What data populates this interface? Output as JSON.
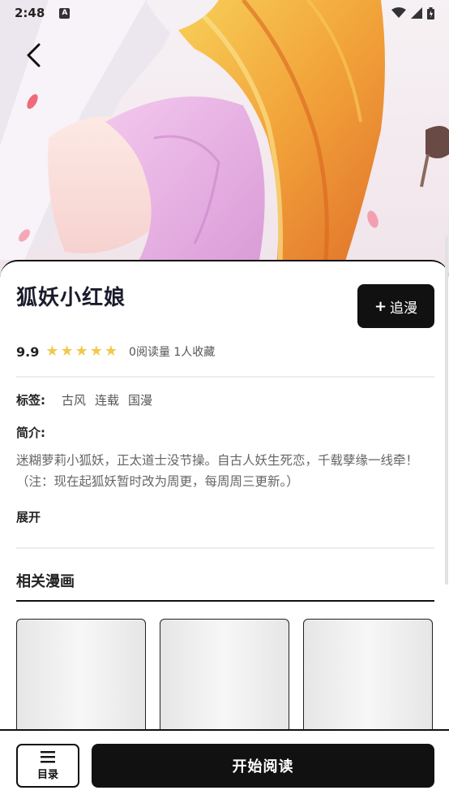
{
  "status_bar": {
    "time": "2:48",
    "notification_icon": "a-icon",
    "icons": [
      "wifi-icon",
      "signal-icon",
      "battery-icon"
    ]
  },
  "header": {
    "back_icon": "chevron-left-icon"
  },
  "comic": {
    "title": "狐妖小红娘",
    "follow_label": "追漫",
    "follow_icon": "+",
    "rating": "9.9",
    "stars": 5,
    "stats": "0阅读量 1人收藏",
    "tags_label": "标签:",
    "tags": [
      "古风",
      "连载",
      "国漫"
    ],
    "intro_label": "简介:",
    "intro": "迷糊萝莉小狐妖，正太道士没节操。自古人妖生死恋，千载孽缘一线牵！（注：现在起狐妖暂时改为周更，每周周三更新。）",
    "expand_label": "展开"
  },
  "related": {
    "title": "相关漫画",
    "items": [
      {},
      {},
      {}
    ]
  },
  "bottom_bar": {
    "toc_label": "目录",
    "read_label": "开始阅读"
  },
  "colors": {
    "accent": "#111111",
    "star": "#f2c94c",
    "hair": "#f0a23a"
  }
}
